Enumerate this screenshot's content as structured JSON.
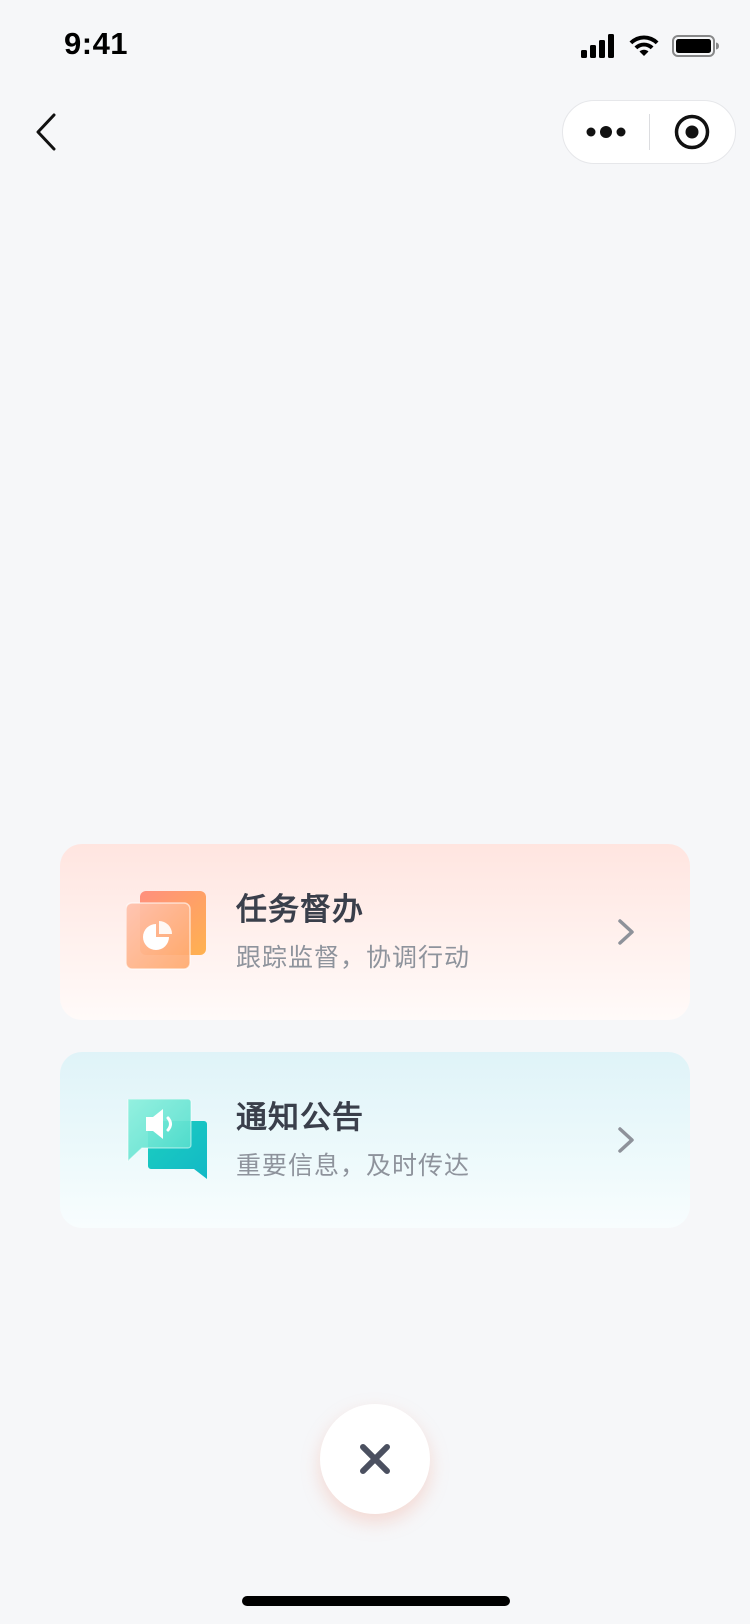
{
  "status_bar": {
    "time": "9:41",
    "icons": [
      "cellular-signal-icon",
      "wifi-icon",
      "battery-icon"
    ]
  },
  "nav": {
    "back_icon": "chevron-left-icon",
    "capsule_more_icon": "more-dots-icon",
    "capsule_close_icon": "target-circle-icon"
  },
  "cards": [
    {
      "id": "task",
      "title": "任务督办",
      "subtitle": "跟踪监督，协调行动",
      "icon": "pie-chart-document-icon",
      "arrow_icon": "chevron-right-icon",
      "colors": {
        "accent_start": "#ff8a7a",
        "accent_end": "#ffb155"
      }
    },
    {
      "id": "notice",
      "title": "通知公告",
      "subtitle": "重要信息，及时传达",
      "icon": "speaker-chat-icon",
      "arrow_icon": "chevron-right-icon",
      "colors": {
        "accent_start": "#7fe3d6",
        "accent_end": "#14c4c4"
      }
    }
  ],
  "close_button": {
    "icon": "close-x-icon",
    "color": "#4b5060"
  }
}
